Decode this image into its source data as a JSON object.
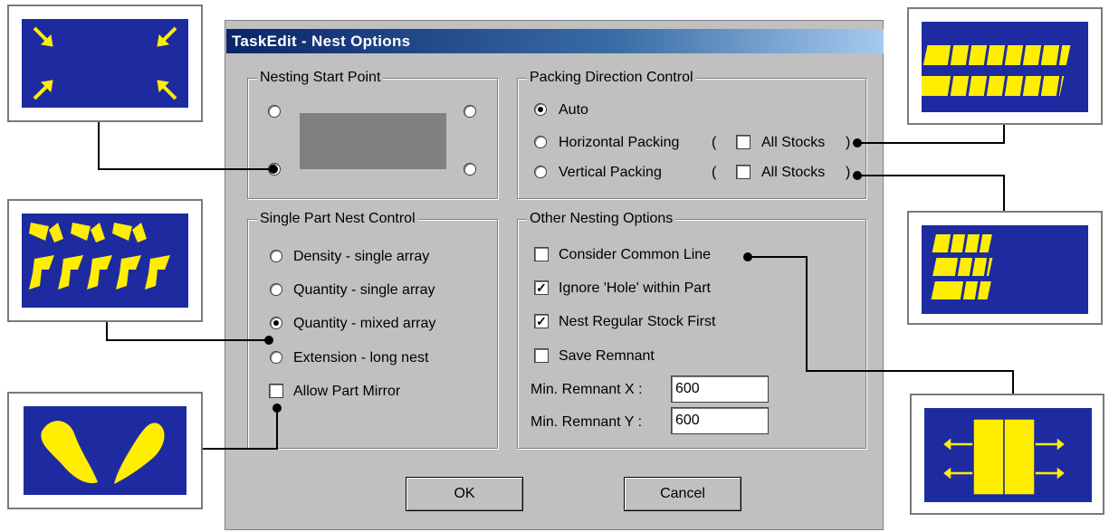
{
  "dialog": {
    "title": "TaskEdit - Nest Options",
    "start_point": {
      "legend": "Nesting Start Point",
      "selected": "bottom-left"
    },
    "packing": {
      "legend": "Packing Direction Control",
      "auto_label": "Auto",
      "horizontal_label": "Horizontal Packing",
      "vertical_label": "Vertical Packing",
      "open_paren": "(",
      "close_paren": ")",
      "all_stocks_label": "All Stocks",
      "selected": "auto"
    },
    "single_part": {
      "legend": "Single Part Nest Control",
      "density_label": "Density - single array",
      "quantity_single_label": "Quantity - single array",
      "quantity_mixed_label": "Quantity - mixed array",
      "extension_label": "Extension - long nest",
      "allow_mirror_label": "Allow Part Mirror",
      "selected": "quantity-mixed"
    },
    "other": {
      "legend": "Other Nesting Options",
      "common_line_label": "Consider Common Line",
      "ignore_hole_label": "Ignore 'Hole' within Part",
      "regular_stock_label": "Nest Regular Stock First",
      "save_remnant_label": "Save Remnant",
      "min_x_label": "Min. Remnant X :",
      "min_y_label": "Min. Remnant Y :",
      "min_x_value": "600",
      "min_y_value": "600",
      "check_mark": "✓"
    },
    "ok_label": "OK",
    "cancel_label": "Cancel"
  },
  "colors": {
    "illustration_bg": "#1e2ba0",
    "illustration_shape": "#ffee00",
    "dialog_bg": "#c0c0c0"
  }
}
